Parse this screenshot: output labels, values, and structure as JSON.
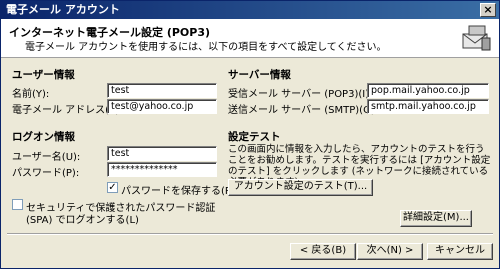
{
  "window": {
    "title": "電子メール アカウント",
    "close_glyph": "×"
  },
  "header": {
    "title": "インターネット電子メール設定 (POP3)",
    "subtitle": "電子メール アカウントを使用するには、以下の項目をすべて設定してください。",
    "icon": "mail-server-icon"
  },
  "user_info": {
    "heading": "ユーザー情報",
    "name_label": "名前(Y):",
    "name_value": "test",
    "email_label": "電子メール アドレス(E):",
    "email_value": "test@yahoo.co.jp"
  },
  "server_info": {
    "heading": "サーバー情報",
    "incoming_label": "受信メール サーバー (POP3)(I):",
    "incoming_value": "pop.mail.yahoo.co.jp",
    "outgoing_label": "送信メール サーバー (SMTP)(O):",
    "outgoing_value": "smtp.mail.yahoo.co.jp"
  },
  "login_info": {
    "heading": "ログオン情報",
    "username_label": "ユーザー名(U):",
    "username_value": "test",
    "password_label": "パスワード(P):",
    "password_value": "**************",
    "remember_label": "パスワードを保存する(R)",
    "remember_checked": "✓",
    "spa_label_line1": "セキュリティで保護されたパスワード認証",
    "spa_label_line2": "(SPA) でログオンする(L)"
  },
  "test_settings": {
    "heading": "設定テスト",
    "description": "この画面内に情報を入力したら、アカウントのテストを行うことをお勧めします。テストを実行するには [アカウント設定のテスト] をクリックします (ネットワークに接続されている必要があります)。",
    "test_button": "アカウント設定のテスト(T)..."
  },
  "buttons": {
    "advanced": "詳細設定(M)...",
    "back": "< 戻る(B)",
    "next": "次へ(N) >",
    "cancel": "キャンセル"
  }
}
